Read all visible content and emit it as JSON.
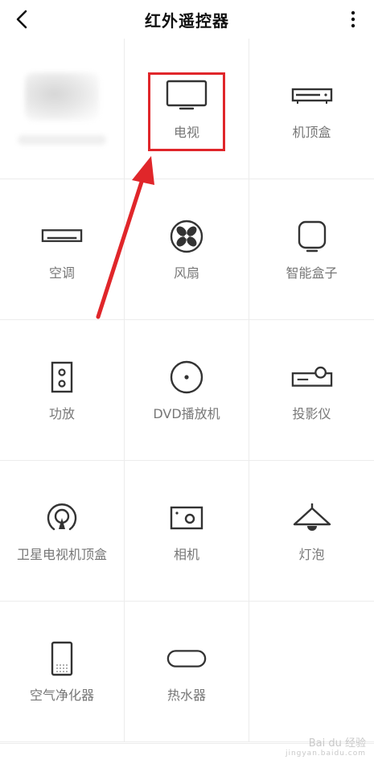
{
  "header": {
    "title": "红外遥控器"
  },
  "devices": [
    {
      "label": ""
    },
    {
      "label": "电视"
    },
    {
      "label": "机顶盒"
    },
    {
      "label": "空调"
    },
    {
      "label": "风扇"
    },
    {
      "label": "智能盒子"
    },
    {
      "label": "功放"
    },
    {
      "label": "DVD播放机"
    },
    {
      "label": "投影仪"
    },
    {
      "label": "卫星电视机顶盒"
    },
    {
      "label": "相机"
    },
    {
      "label": "灯泡"
    },
    {
      "label": "空气净化器"
    },
    {
      "label": "热水器"
    },
    {
      "label": ""
    }
  ],
  "watermark": {
    "brand": "Bai du 经验",
    "url": "jingyan.baidu.com"
  },
  "colors": {
    "highlight": "#e0262a",
    "icon_stroke": "#333333",
    "label": "#777777"
  }
}
